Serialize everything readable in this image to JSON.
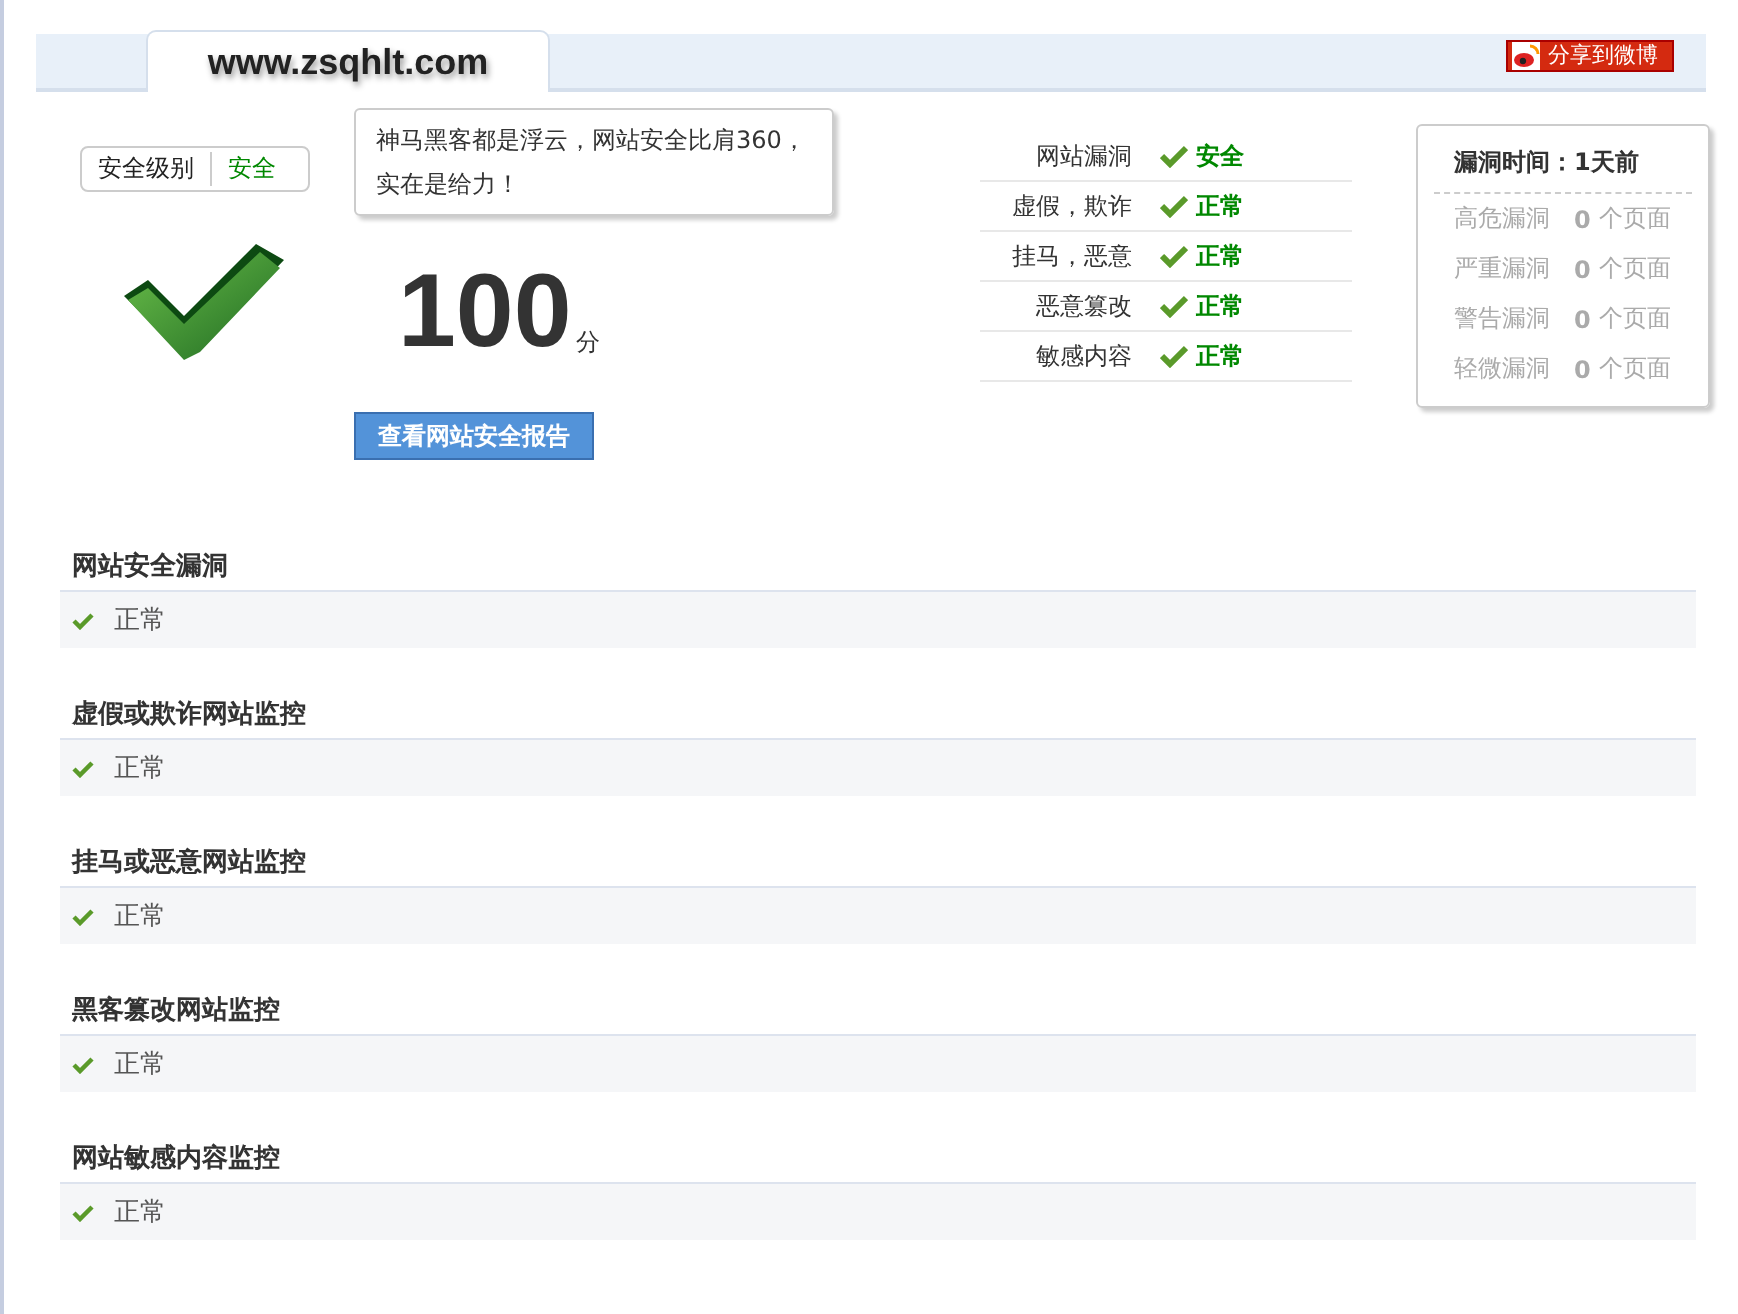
{
  "header": {
    "site_tab": "www.zsqhlt.com",
    "share_button": "分享到微博"
  },
  "level_badge": {
    "label": "安全级别",
    "value": "安全"
  },
  "speech_bubble": "神马黑客都是浮云，网站安全比肩360，实在是给力！",
  "score": {
    "value": "100",
    "unit": "分"
  },
  "report_button": "查看网站安全报告",
  "checks": [
    {
      "label": "网站漏洞",
      "status": "安全"
    },
    {
      "label": "虚假，欺诈",
      "status": "正常"
    },
    {
      "label": "挂马，恶意",
      "status": "正常"
    },
    {
      "label": "恶意篡改",
      "status": "正常"
    },
    {
      "label": "敏感内容",
      "status": "正常"
    }
  ],
  "vuln_popup": {
    "title": "漏洞时间：1天前",
    "rows": [
      {
        "label": "高危漏洞",
        "count": "0",
        "unit": "个页面"
      },
      {
        "label": "严重漏洞",
        "count": "0",
        "unit": "个页面"
      },
      {
        "label": "警告漏洞",
        "count": "0",
        "unit": "个页面"
      },
      {
        "label": "轻微漏洞",
        "count": "0",
        "unit": "个页面"
      }
    ]
  },
  "sections": [
    {
      "title": "网站安全漏洞",
      "result": "正常"
    },
    {
      "title": "虚假或欺诈网站监控",
      "result": "正常"
    },
    {
      "title": "挂马或恶意网站监控",
      "result": "正常"
    },
    {
      "title": "黑客篡改网站监控",
      "result": "正常"
    },
    {
      "title": "网站敏感内容监控",
      "result": "正常"
    }
  ]
}
